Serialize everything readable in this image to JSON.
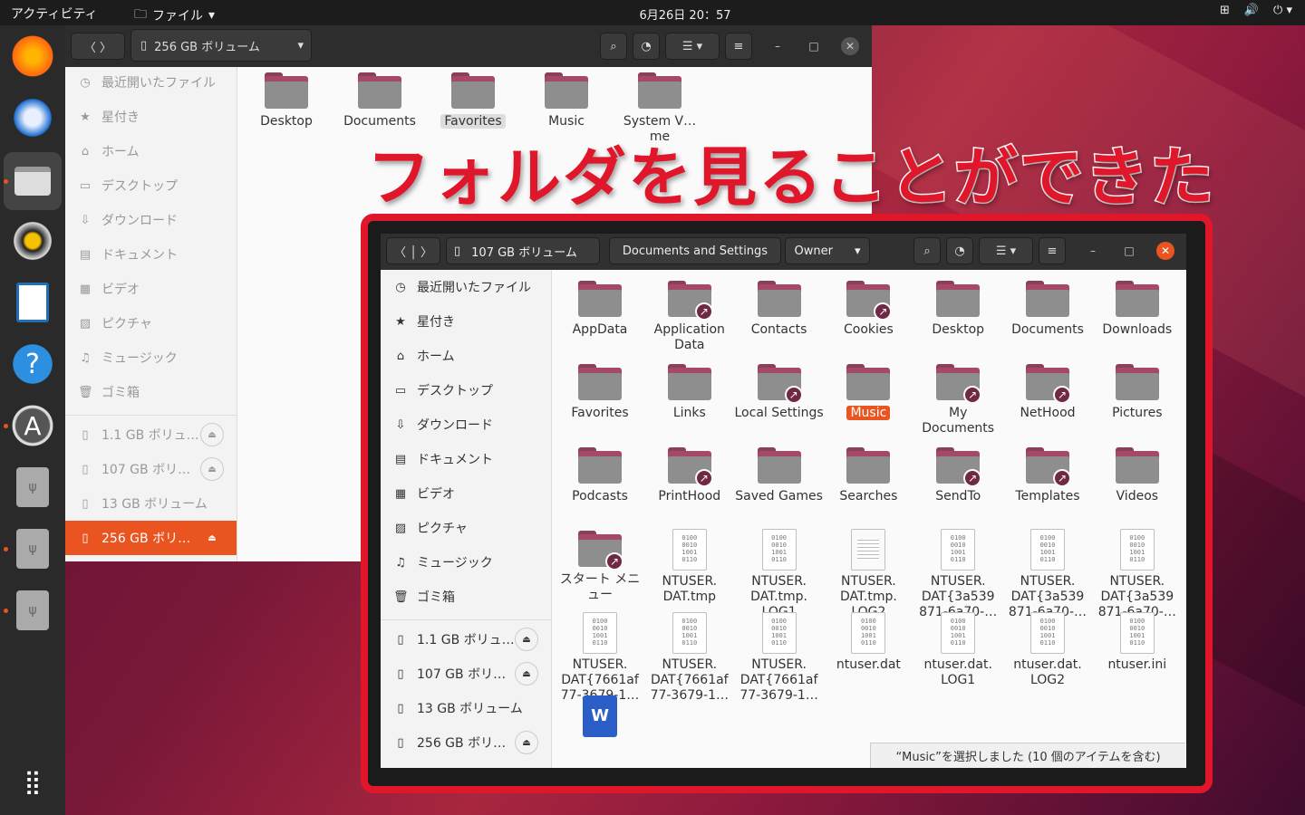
{
  "topbar": {
    "activities": "アクティビティ",
    "app_menu": "ファイル",
    "clock": "6月26日  20：57"
  },
  "caption": "フォルダを見ることができた",
  "back": {
    "path": "256 GB ボリューム",
    "sidebar": [
      "最近開いたファイル",
      "星付き",
      "ホーム",
      "デスクトップ",
      "ダウンロード",
      "ドキュメント",
      "ビデオ",
      "ピクチャ",
      "ミュージック",
      "ゴミ箱"
    ],
    "volumes": [
      "1.1 GB ボリュ…",
      "107 GB ボリ…",
      "13 GB ボリューム",
      "256 GB ボリ…"
    ],
    "folders": [
      "Desktop",
      "Documents",
      "Favorites",
      "Music",
      "System V…me"
    ]
  },
  "front": {
    "crumbs": [
      "107 GB ボリューム",
      "Documents and Settings",
      "Owner"
    ],
    "sidebar": [
      "最近開いたファイル",
      "星付き",
      "ホーム",
      "デスクトップ",
      "ダウンロード",
      "ドキュメント",
      "ビデオ",
      "ピクチャ",
      "ミュージック",
      "ゴミ箱"
    ],
    "volumes": [
      "1.1 GB ボリュ…",
      "107 GB ボリ…",
      "13 GB ボリューム",
      "256 GB ボリ…"
    ],
    "items": [
      {
        "n": "AppData",
        "t": "f"
      },
      {
        "n": "Application Data",
        "t": "l"
      },
      {
        "n": "Contacts",
        "t": "f"
      },
      {
        "n": "Cookies",
        "t": "l"
      },
      {
        "n": "Desktop",
        "t": "f"
      },
      {
        "n": "Documents",
        "t": "f"
      },
      {
        "n": "Downloads",
        "t": "f"
      },
      {
        "n": "Favorites",
        "t": "f"
      },
      {
        "n": "Links",
        "t": "f"
      },
      {
        "n": "Local Settings",
        "t": "l"
      },
      {
        "n": "Music",
        "t": "f",
        "sel": true
      },
      {
        "n": "My Documents",
        "t": "l"
      },
      {
        "n": "NetHood",
        "t": "l"
      },
      {
        "n": "Pictures",
        "t": "f"
      },
      {
        "n": "Podcasts",
        "t": "f"
      },
      {
        "n": "PrintHood",
        "t": "l"
      },
      {
        "n": "Saved Games",
        "t": "f"
      },
      {
        "n": "Searches",
        "t": "f"
      },
      {
        "n": "SendTo",
        "t": "l"
      },
      {
        "n": "Templates",
        "t": "l"
      },
      {
        "n": "Videos",
        "t": "f"
      },
      {
        "n": "スタート メニュー",
        "t": "l"
      },
      {
        "n": "NTUSER. DAT.tmp",
        "t": "b"
      },
      {
        "n": "NTUSER. DAT.tmp. LOG1",
        "t": "b"
      },
      {
        "n": "NTUSER. DAT.tmp. LOG2",
        "t": "x"
      },
      {
        "n": "NTUSER. DAT{3a539 871-6a70-…",
        "t": "b"
      },
      {
        "n": "NTUSER. DAT{3a539 871-6a70-…",
        "t": "b"
      },
      {
        "n": "NTUSER. DAT{3a539 871-6a70-…",
        "t": "b"
      },
      {
        "n": "NTUSER. DAT{7661af 77-3679-1…",
        "t": "b"
      },
      {
        "n": "NTUSER. DAT{7661af 77-3679-1…",
        "t": "b"
      },
      {
        "n": "NTUSER. DAT{7661af 77-3679-1…",
        "t": "b"
      },
      {
        "n": "ntuser.dat",
        "t": "b"
      },
      {
        "n": "ntuser.dat. LOG1",
        "t": "b"
      },
      {
        "n": "ntuser.dat. LOG2",
        "t": "b"
      },
      {
        "n": "ntuser.ini",
        "t": "b"
      },
      {
        "n": "",
        "t": "w"
      }
    ],
    "status": "“Music”を選択しました (10 個のアイテムを含む)"
  },
  "binary_glyph": "0100 0010 1001 0110",
  "colors": {
    "accent": "#e95420",
    "highlight": "#e0162b"
  }
}
